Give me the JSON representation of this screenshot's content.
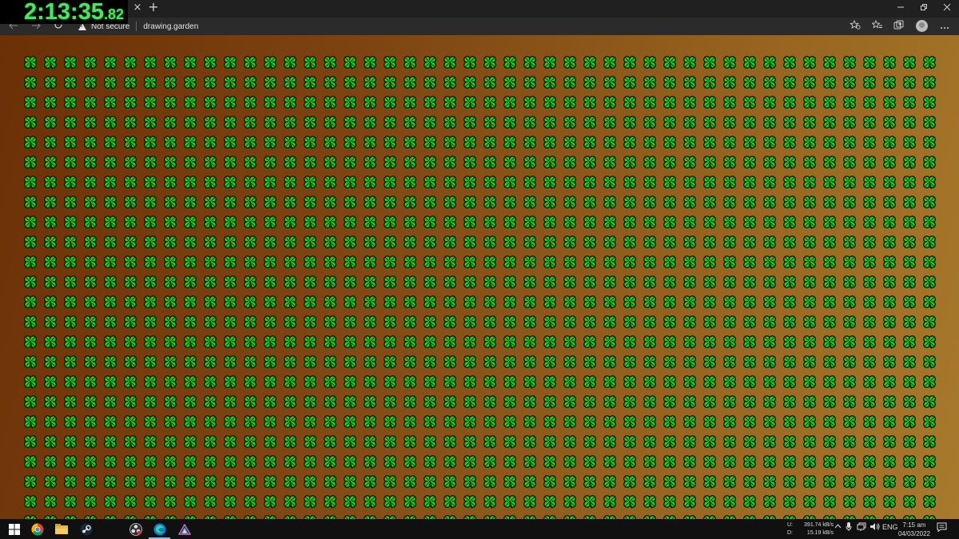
{
  "timer": {
    "main": "2:13:35",
    "fraction": ".82"
  },
  "browser": {
    "tab_close_glyph": "×",
    "new_tab_glyph": "+",
    "security_label": "Not secure",
    "url": "drawing.garden"
  },
  "canvas": {
    "rows": 24,
    "columns": 46,
    "clover_color": "#22cc22",
    "clover_outline": "#0b1a08",
    "background_colors": [
      "#6b3005",
      "#a87a2c"
    ]
  },
  "taskbar": {
    "net_upload_label": "U:",
    "net_upload": "391.74 kB/s",
    "net_download_label": "D:",
    "net_download": "15.19 kB/s",
    "language": "ENG",
    "time": "7:15 am",
    "date": "04/03/2022"
  },
  "icons": {
    "windows": "windows-icon",
    "chrome": "chrome-icon",
    "folder": "file-explorer-icon",
    "steam": "steam-icon",
    "music": "music-icon",
    "obs": "obs-icon",
    "edge": "edge-icon",
    "app": "app-icon"
  }
}
